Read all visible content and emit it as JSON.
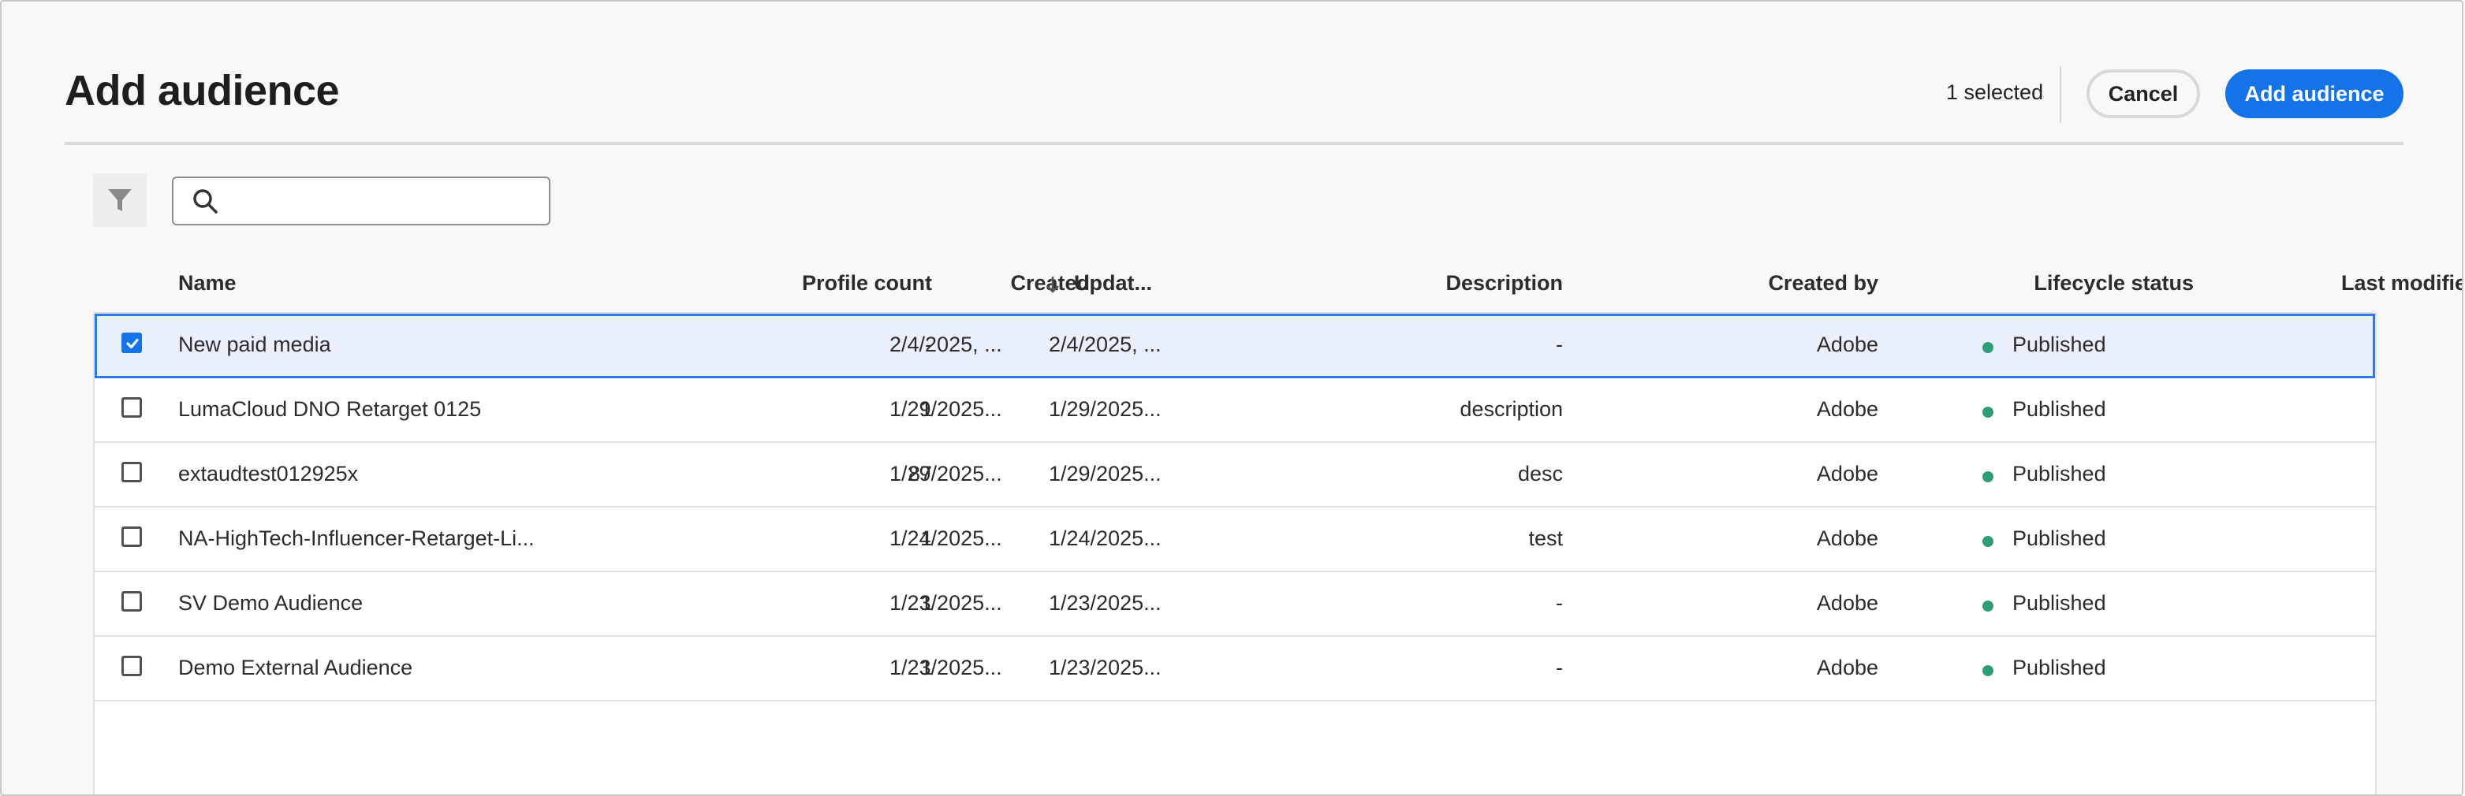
{
  "header": {
    "title": "Add audience",
    "selected_count": "1 selected",
    "cancel_label": "Cancel",
    "add_label": "Add audience"
  },
  "toolbar": {
    "filter_icon": "filter-icon",
    "search_icon": "search-icon",
    "search_value": "",
    "search_placeholder": ""
  },
  "table": {
    "columns": {
      "name": "Name",
      "profile_count": "Profile count",
      "created": "Created",
      "updated": "Updat...",
      "description": "Description",
      "created_by": "Created by",
      "lifecycle_status": "Lifecycle status",
      "last_modified": "Last modifie"
    },
    "sort": {
      "column": "updated",
      "direction": "descending",
      "icon": "arrow-down-icon"
    },
    "rows": [
      {
        "selected": true,
        "name": "New paid media",
        "profile_count": "-",
        "created": "2/4/2025, ...",
        "updated": "2/4/2025, ...",
        "description": "-",
        "created_by": "Adobe",
        "status": "Published"
      },
      {
        "selected": false,
        "name": "LumaCloud DNO Retarget 0125",
        "profile_count": "1",
        "created": "1/29/2025...",
        "updated": "1/29/2025...",
        "description": "description",
        "created_by": "Adobe",
        "status": "Published"
      },
      {
        "selected": false,
        "name": "extaudtest012925x",
        "profile_count": "87",
        "created": "1/29/2025...",
        "updated": "1/29/2025...",
        "description": "desc",
        "created_by": "Adobe",
        "status": "Published"
      },
      {
        "selected": false,
        "name": "NA-HighTech-Influencer-Retarget-Li...",
        "profile_count": "1",
        "created": "1/24/2025...",
        "updated": "1/24/2025...",
        "description": "test",
        "created_by": "Adobe",
        "status": "Published"
      },
      {
        "selected": false,
        "name": "SV Demo Audience",
        "profile_count": "1",
        "created": "1/23/2025...",
        "updated": "1/23/2025...",
        "description": "-",
        "created_by": "Adobe",
        "status": "Published"
      },
      {
        "selected": false,
        "name": "Demo External Audience",
        "profile_count": "1",
        "created": "1/23/2025...",
        "updated": "1/23/2025...",
        "description": "-",
        "created_by": "Adobe",
        "status": "Published"
      }
    ]
  },
  "colors": {
    "accent": "#1473e6",
    "status_published": "#2d9d78",
    "selected_row_bg": "#e9f0fb"
  }
}
